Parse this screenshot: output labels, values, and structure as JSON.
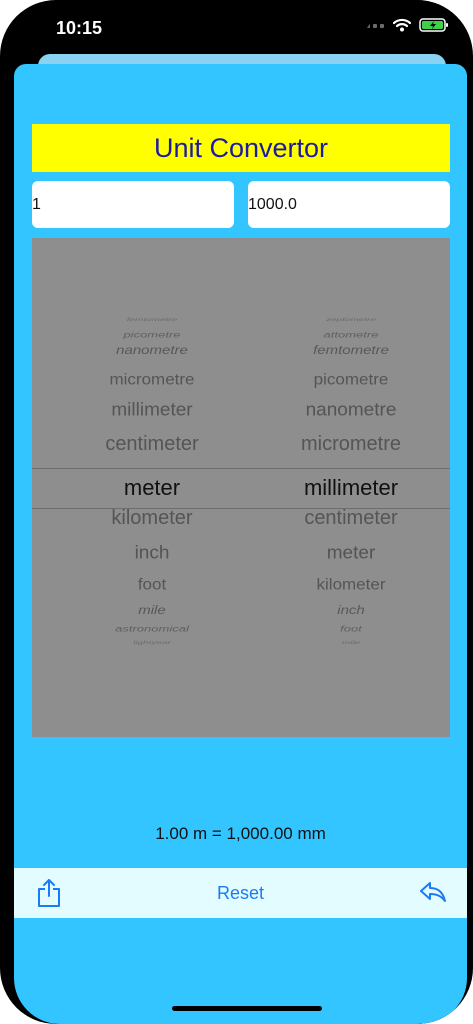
{
  "status_bar": {
    "time": "10:15",
    "icons": [
      "cellular-signal-icon",
      "wifi-icon",
      "battery-charging-icon"
    ]
  },
  "header": {
    "title": "Unit Convertor"
  },
  "inputs": {
    "from_value": "1",
    "to_value": "1000.0"
  },
  "picker": {
    "left": {
      "items": [
        "femtometre",
        "picometre",
        "nanometre",
        "micrometre",
        "millimeter",
        "centimeter",
        "meter",
        "kilometer",
        "inch",
        "foot",
        "mile",
        "astronomical",
        "lightyear"
      ],
      "selected": "meter"
    },
    "right": {
      "items": [
        "zeptometre",
        "attometre",
        "femtometre",
        "picometre",
        "nanometre",
        "micrometre",
        "millimeter",
        "centimeter",
        "meter",
        "kilometer",
        "inch",
        "foot",
        "mile"
      ],
      "selected": "millimeter"
    }
  },
  "result": {
    "text": "1.00 m = 1,000.00 mm"
  },
  "toolbar": {
    "reset_label": "Reset",
    "share_icon": "share-icon",
    "back_icon": "reply-arrow-icon"
  },
  "colors": {
    "background": "#33c5ff",
    "title_bg": "#ffff00",
    "title_text": "#1b1aa3",
    "picker_bg": "#8e8e8e",
    "toolbar_bg": "#e2fcff",
    "accent": "#1a7cf5"
  }
}
